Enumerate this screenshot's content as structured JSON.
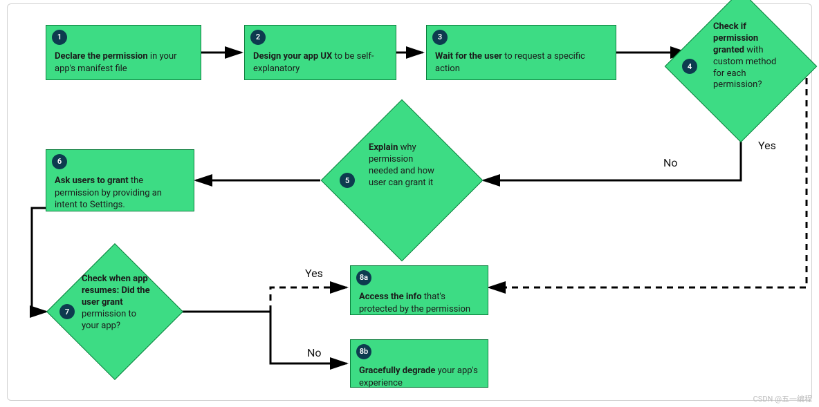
{
  "colors": {
    "node_bg": "#3ddc84",
    "node_border": "#0a7d3b",
    "num_bg": "#0d3b4f"
  },
  "nodes": {
    "n1": {
      "num": "1",
      "title": "Declare the permission",
      "sub": "in your app's manifest file"
    },
    "n2": {
      "num": "2",
      "title": "Design your app UX",
      "sub": "to be self-explanatory"
    },
    "n3": {
      "num": "3",
      "title": "Wait for the user",
      "sub": "to request a specific action"
    },
    "n4": {
      "num": "4",
      "title": "Check if permission granted",
      "sub": "with custom method for each permission?"
    },
    "n5": {
      "num": "5",
      "title": "Explain",
      "sub": "why permission needed and how user can grant it"
    },
    "n6": {
      "num": "6",
      "title": "Ask users to grant",
      "sub": "the permission by providing an intent to Settings."
    },
    "n7": {
      "num": "7",
      "title": "Check when app resumes: Did the user grant",
      "sub": "permission to your app?"
    },
    "n8a": {
      "num": "8a",
      "title": "Access the info",
      "sub": "that's protected by the permission"
    },
    "n8b": {
      "num": "8b",
      "title": "Gracefully degrade",
      "sub": "your app's experience"
    }
  },
  "labels": {
    "yes": "Yes",
    "no": "No"
  },
  "edges": [
    {
      "from": "n1",
      "to": "n2",
      "style": "solid"
    },
    {
      "from": "n2",
      "to": "n3",
      "style": "solid"
    },
    {
      "from": "n3",
      "to": "n4",
      "style": "solid"
    },
    {
      "from": "n4",
      "to": "n5",
      "label": "No",
      "style": "solid"
    },
    {
      "from": "n4",
      "to": "n8a",
      "label": "Yes",
      "style": "dashed"
    },
    {
      "from": "n5",
      "to": "n6",
      "style": "solid"
    },
    {
      "from": "n6",
      "to": "n7",
      "style": "solid"
    },
    {
      "from": "n7",
      "to": "n8a",
      "label": "Yes",
      "style": "dashed"
    },
    {
      "from": "n7",
      "to": "n8b",
      "label": "No",
      "style": "solid"
    }
  ],
  "watermark": "CSDN @五一编程"
}
